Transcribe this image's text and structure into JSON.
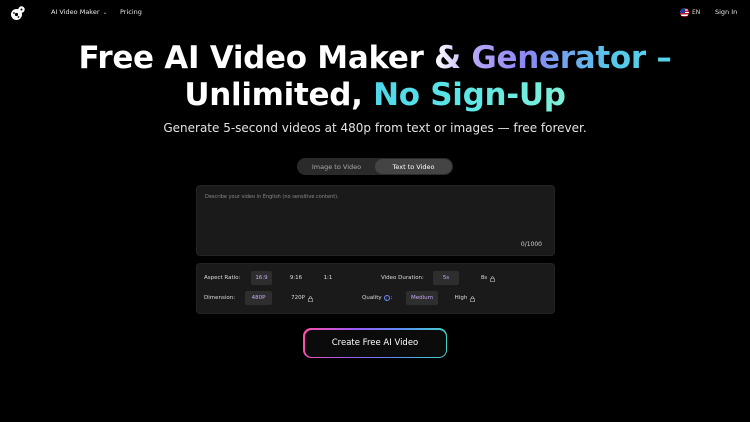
{
  "nav": {
    "ai_video_maker": "AI Video Maker",
    "pricing": "Pricing",
    "language": "EN",
    "sign_in": "Sign In"
  },
  "hero": {
    "title_line1": "Free AI Video Maker & Generator –",
    "title_line2_a": "Unlimited",
    "title_line2_b": ", ",
    "title_line2_c": "No Sign-Up",
    "subtitle": "Generate 5-second videos at 480p from text or images — free forever."
  },
  "tabs": [
    {
      "label": "Image to Video",
      "active": false
    },
    {
      "label": "Text to Video",
      "active": true
    }
  ],
  "prompt": {
    "placeholder": "Describe your video in English (no sensitive content).",
    "value": "",
    "counter": "0/1000"
  },
  "settings": {
    "aspect_ratio_label": "Aspect Ratio:",
    "aspect_options": [
      "16:9",
      "9:16",
      "1:1"
    ],
    "aspect_selected": "16:9",
    "duration_label": "Video Duration:",
    "duration_options": [
      "5s",
      "8s"
    ],
    "duration_selected": "5s",
    "dimension_label": "Dimension:",
    "dimension_options": [
      "480P",
      "720P"
    ],
    "dimension_selected": "480P",
    "quality_label": "Quality",
    "quality_suffix": ":",
    "quality_options": [
      "Medium",
      "High"
    ],
    "quality_selected": "Medium",
    "info_glyph": "i"
  },
  "cta": {
    "label": "Create Free AI Video"
  },
  "colors": {
    "background": "#000000",
    "selected_text": "#c9a8f5",
    "gradient_cyan": "#5ee0ef"
  }
}
